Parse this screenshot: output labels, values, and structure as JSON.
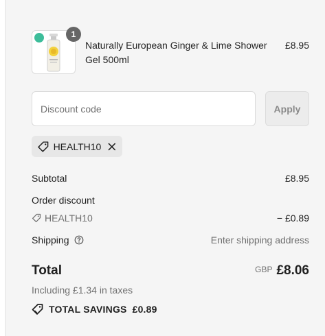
{
  "product": {
    "quantity": "1",
    "name": "Naturally European Ginger & Lime Shower Gel 500ml",
    "price": "£8.95",
    "image_icon": "shower-gel-bottle"
  },
  "discount": {
    "placeholder": "Discount code",
    "apply_label": "Apply",
    "applied_code": "HEALTH10"
  },
  "summary": {
    "subtotal_label": "Subtotal",
    "subtotal_value": "£8.95",
    "order_discount_label": "Order discount",
    "discount_code": "HEALTH10",
    "discount_value": "− £0.89",
    "shipping_label": "Shipping",
    "shipping_value": "Enter shipping address",
    "total_label": "Total",
    "currency": "GBP",
    "total_value": "£8.06",
    "taxes_note": "Including £1.34 in taxes",
    "savings_label": "TOTAL SAVINGS",
    "savings_value": "£0.89"
  },
  "colors": {
    "background": "#f5f5f5",
    "badge": "#666666",
    "tag_background": "#e7e7e7",
    "muted_text": "#707070"
  }
}
